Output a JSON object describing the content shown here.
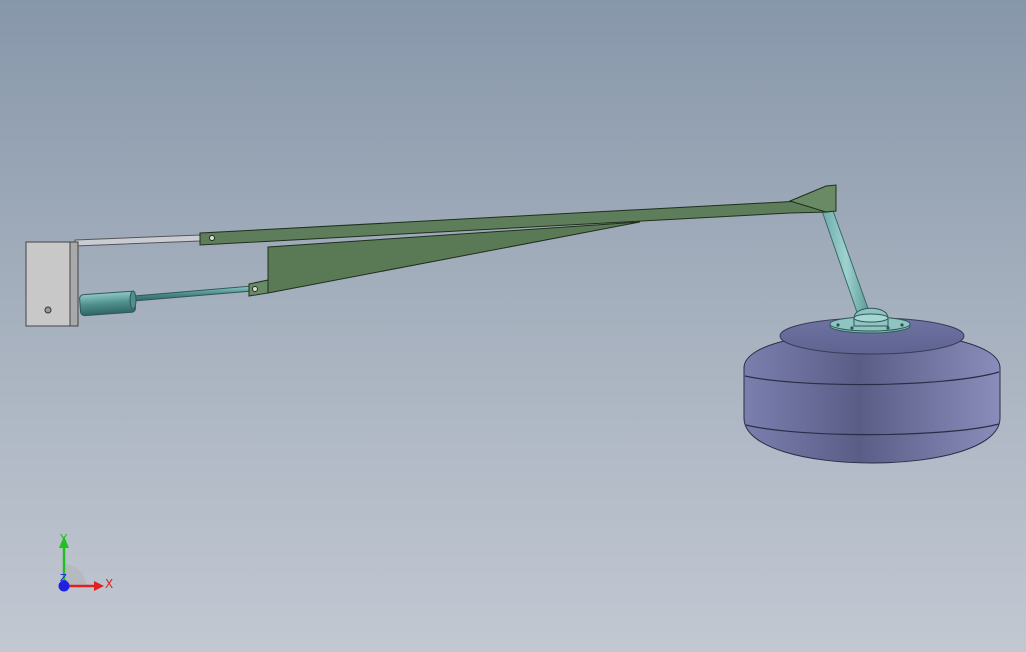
{
  "viewport": {
    "background_top": "#8797aa",
    "background_bottom": "#c2c8d2"
  },
  "model": {
    "parts": [
      "mounting-bracket",
      "boom-arm",
      "hydraulic-cylinder",
      "support-strut",
      "float-wheel"
    ],
    "colors": {
      "boom": "#5e7d5a",
      "cylinder": "#5f9c9a",
      "bracket": "#c8c8c8",
      "wheel": "#6a6e98"
    }
  },
  "triad": {
    "x_label": "X",
    "y_label": "Y",
    "z_label": "Z",
    "x_color": "#e02020",
    "y_color": "#20c020",
    "z_color": "#2020e0"
  }
}
